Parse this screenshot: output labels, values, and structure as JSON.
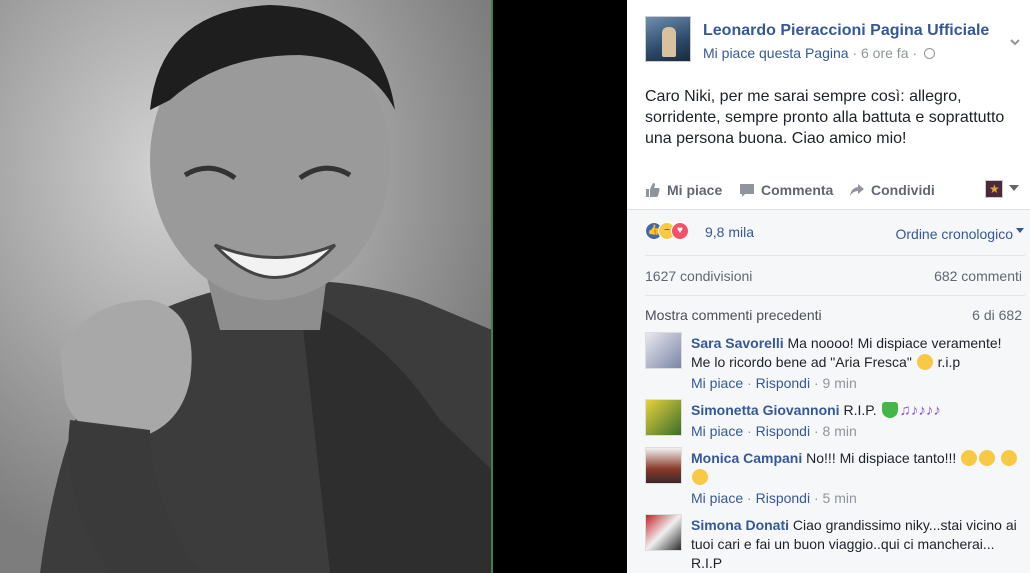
{
  "post": {
    "page_name": "Leonardo Pieraccioni Pagina Ufficiale",
    "like_page": "Mi piace questa Pagina",
    "time": "6 ore fa",
    "text": "Caro Niki, per me sarai sempre così: allegro, sorridente, sempre pronto alla battuta e soprattutto una persona buona. Ciao amico mio!"
  },
  "actions": {
    "like": "Mi piace",
    "comment": "Commenta",
    "share": "Condividi"
  },
  "stats": {
    "reactions_count": "9,8 mila",
    "order": "Ordine cronologico",
    "shares": "1627 condivisioni",
    "comments": "682 commenti",
    "previous": "Mostra commenti precedenti",
    "page_of": "6 di 682"
  },
  "comments": [
    {
      "name": "Sara Savorelli",
      "text": "Ma noooo! Mi dispiace veramente! Me lo ricordo bene ad \"Aria Fresca\"",
      "suffix": "r.i.p",
      "like": "Mi piace",
      "reply": "Rispondi",
      "time": "9 min"
    },
    {
      "name": "Simonetta Giovannoni",
      "text": "R.I.P.",
      "like": "Mi piace",
      "reply": "Rispondi",
      "time": "8 min"
    },
    {
      "name": "Monica Campani",
      "text": "No!!! Mi dispiace tanto!!!",
      "like": "Mi piace",
      "reply": "Rispondi",
      "time": "5 min"
    },
    {
      "name": "Simona Donati",
      "text": "Ciao grandissimo niky...stai vicino ai tuoi cari e fai un buon viaggio..qui ci mancherai... R.I.P"
    }
  ],
  "icons": [
    "globe-icon",
    "chevron-down-icon",
    "thumbs-up-icon",
    "comment-icon",
    "share-icon"
  ],
  "colors": {
    "link": "#365899",
    "like_reaction": "#4267b2",
    "love_reaction": "#f25268",
    "photo_border": "#3f7f3f"
  }
}
